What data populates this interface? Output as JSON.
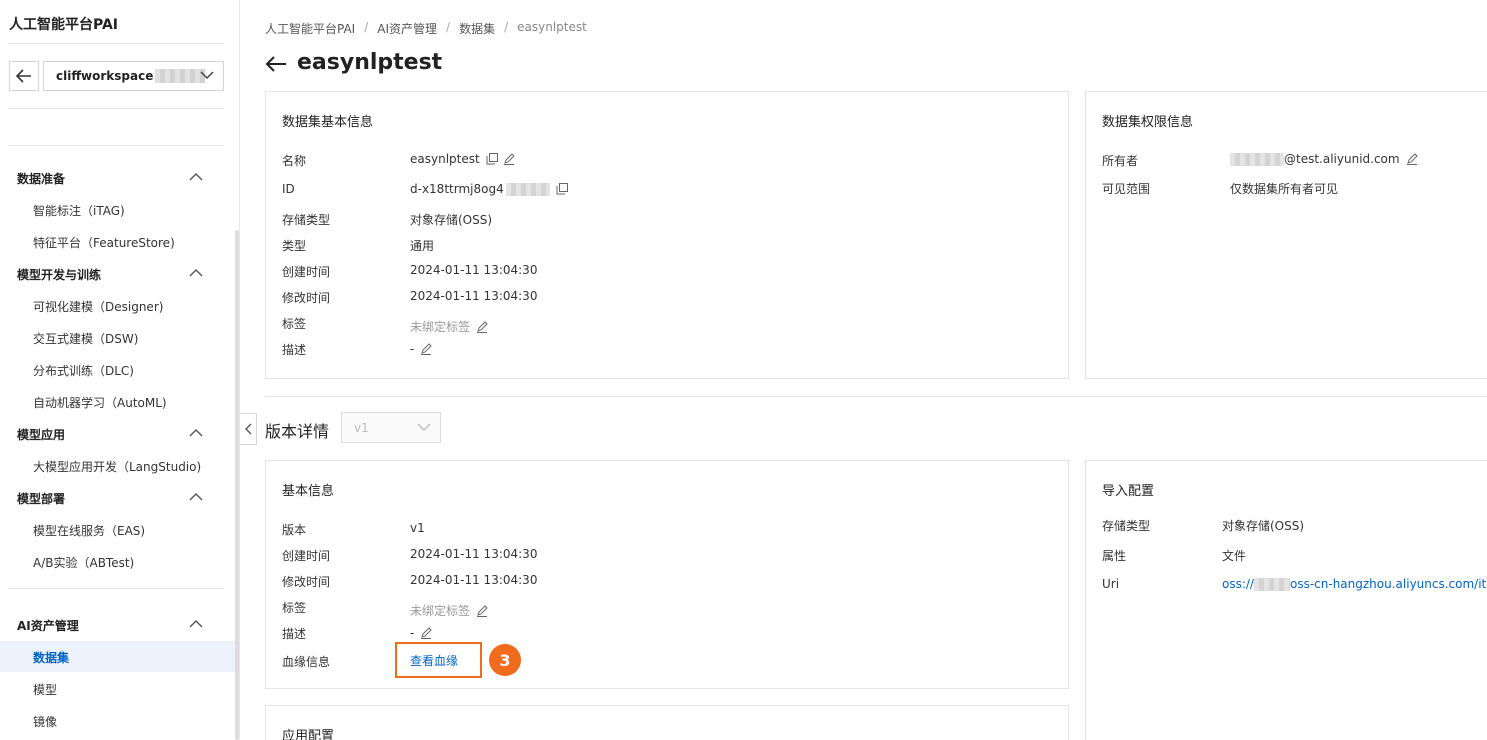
{
  "sidebar": {
    "brand": "人工智能平台PAI",
    "workspace": "cliffworkspace",
    "groups": [
      {
        "label": "数据准备",
        "items": [
          "智能标注（iTAG)",
          "特征平台（FeatureStore)"
        ]
      },
      {
        "label": "模型开发与训练",
        "items": [
          "可视化建模（Designer)",
          "交互式建模（DSW)",
          "分布式训练（DLC)",
          "自动机器学习（AutoML)"
        ]
      },
      {
        "label": "模型应用",
        "items": [
          "大模型应用开发（LangStudio)"
        ]
      },
      {
        "label": "模型部署",
        "items": [
          "模型在线服务（EAS)",
          "A/B实验（ABTest)"
        ]
      },
      {
        "label": "AI资产管理",
        "items": [
          "数据集",
          "模型",
          "镜像"
        ]
      }
    ],
    "active_item": "数据集"
  },
  "breadcrumb": [
    "人工智能平台PAI",
    "AI资产管理",
    "数据集",
    "easynlptest"
  ],
  "breadcrumb_sep": "/",
  "page_title": "easynlptest",
  "dataset_info": {
    "title": "数据集基本信息",
    "rows": [
      {
        "label": "名称",
        "value": "easynlptest"
      },
      {
        "label": "ID",
        "value": "d-x18ttrmj8og4"
      },
      {
        "label": "存储类型",
        "value": "对象存储(OSS)"
      },
      {
        "label": "类型",
        "value": "通用"
      },
      {
        "label": "创建时间",
        "value": "2024-01-11 13:04:30"
      },
      {
        "label": "修改时间",
        "value": "2024-01-11 13:04:30"
      },
      {
        "label": "标签",
        "value": "未绑定标签"
      },
      {
        "label": "描述",
        "value": "-"
      }
    ]
  },
  "permission_info": {
    "title": "数据集权限信息",
    "rows": [
      {
        "label": "所有者",
        "value": "@test.aliyunid.com"
      },
      {
        "label": "可见范围",
        "value": "仅数据集所有者可见"
      }
    ]
  },
  "version": {
    "label": "版本详情",
    "selected": "v1"
  },
  "basic_info": {
    "title": "基本信息",
    "rows": [
      {
        "label": "版本",
        "value": "v1"
      },
      {
        "label": "创建时间",
        "value": "2024-01-11 13:04:30"
      },
      {
        "label": "修改时间",
        "value": "2024-01-11 13:04:30"
      },
      {
        "label": "标签",
        "value": "未绑定标签"
      },
      {
        "label": "描述",
        "value": "-"
      },
      {
        "label": "血缘信息",
        "value": "查看血缘"
      }
    ],
    "step_badge": "3"
  },
  "import_config": {
    "title": "导入配置",
    "rows": [
      {
        "label": "存储类型",
        "value": "对象存储(OSS)"
      },
      {
        "label": "属性",
        "value": "文件"
      },
      {
        "label": "Uri",
        "value_prefix": "oss://",
        "value_suffix": "oss-cn-hangzhou.aliyuncs.com/itagte"
      }
    ]
  },
  "app_config": {
    "title": "应用配置"
  },
  "colors": {
    "accent": "#0064c8",
    "highlight": "#f06c1c",
    "active_bg": "#eef3fb"
  }
}
